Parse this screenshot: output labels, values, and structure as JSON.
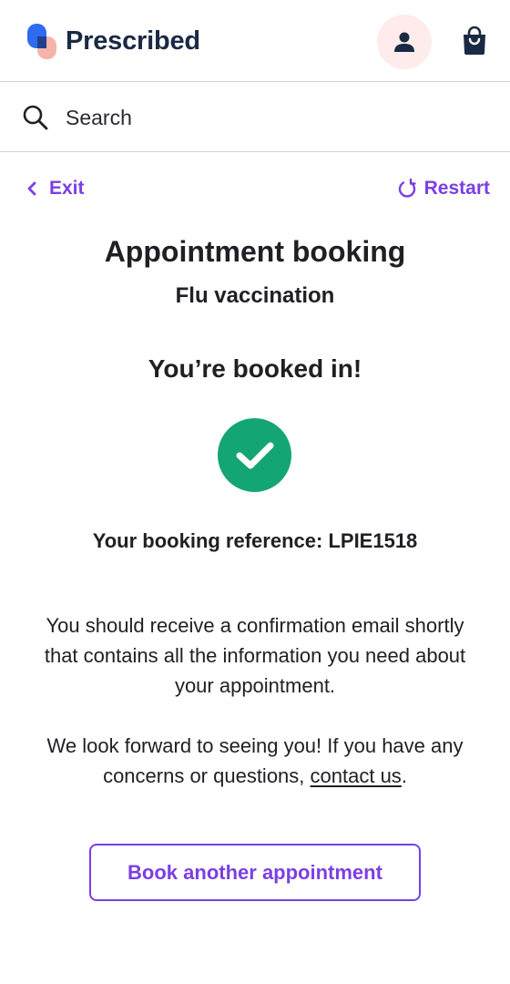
{
  "header": {
    "brand": "Prescribed",
    "account_icon": "person-icon",
    "bag_icon": "shopping-bag-icon"
  },
  "search": {
    "placeholder": "Search",
    "icon": "search-icon"
  },
  "nav": {
    "exit_label": "Exit",
    "restart_label": "Restart"
  },
  "content": {
    "title": "Appointment booking",
    "subtitle": "Flu vaccination",
    "status_heading": "You’re booked in!",
    "reference_label": "Your booking reference:",
    "reference_value": "LPIE1518",
    "info_text": "You should receive a confirmation email shortly that contains all the information you need about your appointment.",
    "thanks_text": "We look forward to seeing you! If you have any concerns or questions,",
    "contact_link": "contact us",
    "thanks_end": "."
  },
  "actions": {
    "book_another": "Book another appointment"
  },
  "colors": {
    "accent": "#7b3fe4",
    "success": "#14a574",
    "brand_text": "#1b2a44",
    "account_bg": "#fdeceb"
  }
}
